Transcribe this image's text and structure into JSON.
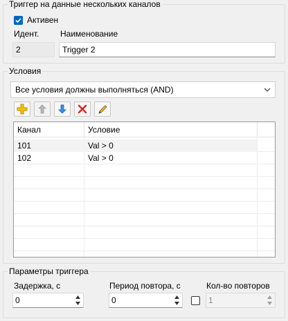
{
  "trigger_group": {
    "title": "Триггер на данные нескольких каналов",
    "active_label": "Активен",
    "active_checked": true,
    "id_label": "Идент.",
    "id_value": "2",
    "name_label": "Наименование",
    "name_value": "Trigger 2"
  },
  "conditions_group": {
    "title": "Условия",
    "mode_selected": "Все условия должны выполняться (AND)",
    "toolbar": {
      "add_icon": "plus-icon",
      "move_up_icon": "arrow-up-icon",
      "move_down_icon": "arrow-down-icon",
      "delete_icon": "delete-x-icon",
      "edit_icon": "pencil-icon"
    },
    "columns": [
      "Канал",
      "Условие"
    ],
    "rows": [
      {
        "channel": "101",
        "condition": "Val > 0"
      },
      {
        "channel": "102",
        "condition": "Val > 0"
      }
    ]
  },
  "params_group": {
    "title": "Параметры триггера",
    "delay_label": "Задержка, с",
    "delay_value": "0",
    "repeat_period_label": "Период повтора, с",
    "repeat_period_value": "0",
    "repeat_count_label": "Кол-во повторов",
    "repeat_count_value": "1",
    "repeat_count_enabled": false
  },
  "colors": {
    "accent": "#0067c0",
    "window_bg": "#f0f0f0",
    "selected_row": "#f3f3f3"
  }
}
